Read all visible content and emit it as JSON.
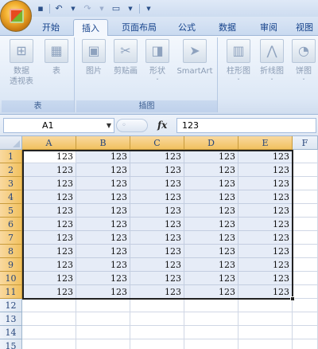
{
  "quick_access": {
    "icons": [
      "save-icon",
      "undo-icon",
      "redo-icon",
      "print-preview-icon"
    ],
    "more_label": "▼"
  },
  "tabs": [
    "开始",
    "插入",
    "页面布局",
    "公式",
    "数据",
    "审阅",
    "视图"
  ],
  "active_tab": "插入",
  "ribbon": {
    "groups": [
      {
        "label": "表",
        "buttons": [
          {
            "label": "数据\n透视表",
            "icon": "pivot-table-icon"
          },
          {
            "label": "表",
            "icon": "table-icon"
          }
        ]
      },
      {
        "label": "插图",
        "buttons": [
          {
            "label": "图片",
            "icon": "picture-icon"
          },
          {
            "label": "剪贴画",
            "icon": "clip-art-icon"
          },
          {
            "label": "形状",
            "icon": "shapes-icon"
          },
          {
            "label": "SmartArt",
            "icon": "smartart-icon"
          }
        ]
      },
      {
        "label": "",
        "buttons": [
          {
            "label": "柱形图",
            "icon": "column-chart-icon"
          },
          {
            "label": "折线图",
            "icon": "line-chart-icon"
          },
          {
            "label": "饼图",
            "icon": "pie-chart-icon"
          }
        ]
      }
    ]
  },
  "formula_bar": {
    "name_box": "A1",
    "fx_label": "fx",
    "formula": "123"
  },
  "sheet": {
    "columns": [
      "A",
      "B",
      "C",
      "D",
      "E",
      "F"
    ],
    "rows": [
      "1",
      "2",
      "3",
      "4",
      "5",
      "6",
      "7",
      "8",
      "9",
      "10",
      "11",
      "12",
      "13",
      "14",
      "15"
    ],
    "cell_value": "123",
    "filled_rows": 11,
    "filled_cols": 5,
    "selection": "A1:E11"
  },
  "colors": {
    "selected_header": "#f1c15f",
    "selection_fill": "#e6ecf7",
    "ribbon_text": "#15428b"
  }
}
